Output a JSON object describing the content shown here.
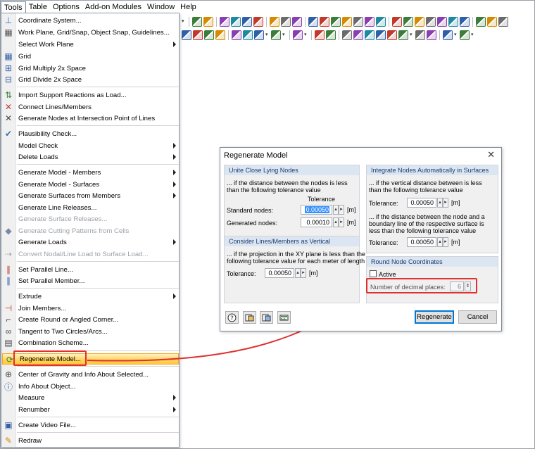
{
  "menubar": {
    "items": [
      "Tools",
      "Table",
      "Options",
      "Add-on Modules",
      "Window",
      "Help"
    ]
  },
  "menu": {
    "items": [
      {
        "label": "Coordinate System...",
        "submenu": false,
        "disabled": false,
        "icon": "coordinate-system-icon"
      },
      {
        "label": "Work Plane, Grid/Snap, Object Snap, Guidelines...",
        "submenu": false,
        "disabled": false,
        "icon": "work-plane-icon"
      },
      {
        "label": "Select Work Plane",
        "submenu": true,
        "disabled": false,
        "icon": ""
      },
      {
        "label": "Grid",
        "submenu": false,
        "disabled": false,
        "icon": "grid-icon"
      },
      {
        "label": "Grid Multiply 2x Space",
        "submenu": false,
        "disabled": false,
        "icon": "grid-multiply-icon"
      },
      {
        "label": "Grid Divide 2x Space",
        "submenu": false,
        "disabled": false,
        "icon": "grid-divide-icon"
      },
      {
        "label": "Import Support Reactions as Load...",
        "submenu": false,
        "disabled": false,
        "icon": "import-reactions-icon"
      },
      {
        "label": "Connect Lines/Members",
        "submenu": false,
        "disabled": false,
        "icon": "connect-lines-icon"
      },
      {
        "label": "Generate Nodes at Intersection Point of Lines",
        "submenu": false,
        "disabled": false,
        "icon": "intersection-nodes-icon"
      },
      {
        "label": "Plausibility Check...",
        "submenu": false,
        "disabled": false,
        "icon": "plausibility-check-icon"
      },
      {
        "label": "Model Check",
        "submenu": true,
        "disabled": false,
        "icon": ""
      },
      {
        "label": "Delete Loads",
        "submenu": true,
        "disabled": false,
        "icon": ""
      },
      {
        "label": "Generate Model - Members",
        "submenu": true,
        "disabled": false,
        "icon": ""
      },
      {
        "label": "Generate Model - Surfaces",
        "submenu": true,
        "disabled": false,
        "icon": ""
      },
      {
        "label": "Generate Surfaces from Members",
        "submenu": true,
        "disabled": false,
        "icon": ""
      },
      {
        "label": "Generate Line Releases...",
        "submenu": false,
        "disabled": false,
        "icon": ""
      },
      {
        "label": "Generate Surface Releases...",
        "submenu": false,
        "disabled": true,
        "icon": ""
      },
      {
        "label": "Generate Cutting Patterns from Cells",
        "submenu": false,
        "disabled": true,
        "icon": "cutting-patterns-icon"
      },
      {
        "label": "Generate Loads",
        "submenu": true,
        "disabled": false,
        "icon": ""
      },
      {
        "label": "Convert Nodal/Line Load to Surface Load...",
        "submenu": false,
        "disabled": true,
        "icon": "convert-load-icon"
      },
      {
        "label": "Set Parallel Line...",
        "submenu": false,
        "disabled": false,
        "icon": "parallel-line-icon"
      },
      {
        "label": "Set Parallel Member...",
        "submenu": false,
        "disabled": false,
        "icon": "parallel-member-icon"
      },
      {
        "label": "Extrude",
        "submenu": true,
        "disabled": false,
        "icon": ""
      },
      {
        "label": "Join Members...",
        "submenu": false,
        "disabled": false,
        "icon": "join-members-icon"
      },
      {
        "label": "Create Round or Angled Corner...",
        "submenu": false,
        "disabled": false,
        "icon": "round-corner-icon"
      },
      {
        "label": "Tangent to Two Circles/Arcs...",
        "submenu": false,
        "disabled": false,
        "icon": "tangent-icon"
      },
      {
        "label": "Combination Scheme...",
        "submenu": false,
        "disabled": false,
        "icon": "combination-scheme-icon"
      },
      {
        "label": "Regenerate Model...",
        "submenu": false,
        "disabled": false,
        "icon": "regenerate-model-icon"
      },
      {
        "label": "Center of Gravity and Info About Selected...",
        "submenu": false,
        "disabled": false,
        "icon": "center-gravity-icon"
      },
      {
        "label": "Info About Object...",
        "submenu": false,
        "disabled": false,
        "icon": "info-object-icon"
      },
      {
        "label": "Measure",
        "submenu": true,
        "disabled": false,
        "icon": ""
      },
      {
        "label": "Renumber",
        "submenu": true,
        "disabled": false,
        "icon": ""
      },
      {
        "label": "Create Video File...",
        "submenu": false,
        "disabled": false,
        "icon": "video-file-icon"
      },
      {
        "label": "Redraw",
        "submenu": false,
        "disabled": false,
        "icon": "redraw-icon"
      }
    ]
  },
  "dialog": {
    "title": "Regenerate Model",
    "close": "✕",
    "unite": {
      "header": "Unite Close Lying Nodes",
      "desc1": "... if the distance between the nodes is less",
      "desc2": "than the following tolerance value",
      "tolerance_label": "Tolerance",
      "standard_label": "Standard nodes:",
      "standard_value": "0.00050",
      "generated_label": "Generated nodes:",
      "generated_value": "0.00010",
      "unit": "[m]"
    },
    "integrate": {
      "header": "Integrate Nodes Automatically in Surfaces",
      "desc1": "... if the vertical distance between is less",
      "desc2": "than the following tolerance value",
      "tol1_label": "Tolerance:",
      "tol1_value": "0.00050",
      "desc3": "... if the distance between the node and a",
      "desc4": "boundary line of the respective surface is",
      "desc5": "less than the following tolerance value",
      "tol2_label": "Tolerance:",
      "tol2_value": "0.00050",
      "unit": "[m]"
    },
    "consider": {
      "header": "Consider Lines/Members as Vertical",
      "desc1": "... if the projection in the XY plane is less than the",
      "desc2": "following tolerance value for each meter of length",
      "tol_label": "Tolerance:",
      "tol_value": "0.00050",
      "unit": "[m]"
    },
    "round": {
      "header": "Round Node Coordinates",
      "active_label": "Active",
      "active_checked": false,
      "decimals_label": "Number of decimal places:",
      "decimals_value": "6"
    },
    "buttons": {
      "regenerate": "Regenerate",
      "cancel": "Cancel"
    }
  },
  "colors": {
    "accent_red": "#e03030",
    "group_header_bg": "#dce6f2",
    "group_header_text": "#1c3c6e",
    "highlight_orange": "#ffd460"
  }
}
